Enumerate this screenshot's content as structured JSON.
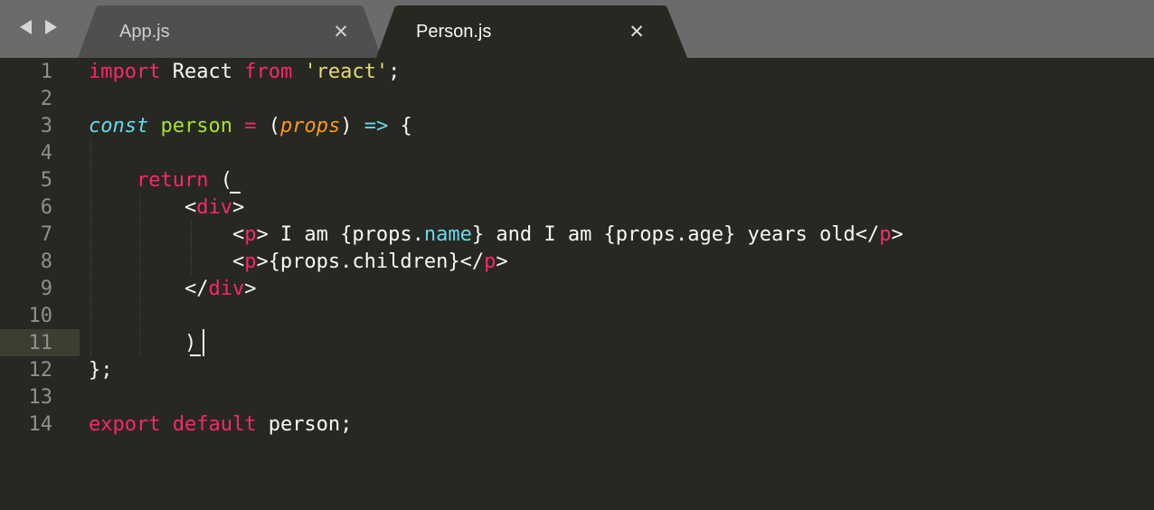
{
  "nav": {
    "back_icon": "back-arrow-icon",
    "forward_icon": "forward-arrow-icon"
  },
  "tabs": [
    {
      "label": "App.js",
      "active": false,
      "close_glyph": "✕"
    },
    {
      "label": "Person.js",
      "active": true,
      "close_glyph": "✕"
    }
  ],
  "colors": {
    "background": "#272822",
    "tabbar": "#6b6b6b",
    "inactive_tab": "#4f4f4f",
    "active_tab": "#272822",
    "line_highlight": "#3e3d32",
    "keyword": "#f92672",
    "string": "#e6db74",
    "storage": "#66d9ef",
    "function": "#a6e22e",
    "parameter": "#fd971f"
  },
  "editor": {
    "current_line": 11,
    "line_numbers": [
      "1",
      "2",
      "3",
      "4",
      "5",
      "6",
      "7",
      "8",
      "9",
      "10",
      "11",
      "12",
      "13",
      "14"
    ],
    "lines": [
      [
        {
          "t": "import",
          "c": "kw"
        },
        {
          "t": " React ",
          "c": "plain"
        },
        {
          "t": "from",
          "c": "kw"
        },
        {
          "t": " ",
          "c": "plain"
        },
        {
          "t": "'react'",
          "c": "str"
        },
        {
          "t": ";",
          "c": "plain"
        }
      ],
      [],
      [
        {
          "t": "const",
          "c": "stor"
        },
        {
          "t": " ",
          "c": "plain"
        },
        {
          "t": "person",
          "c": "fn"
        },
        {
          "t": " ",
          "c": "plain"
        },
        {
          "t": "=",
          "c": "op"
        },
        {
          "t": " (",
          "c": "plain"
        },
        {
          "t": "props",
          "c": "param"
        },
        {
          "t": ") ",
          "c": "plain"
        },
        {
          "t": "=>",
          "c": "arrow"
        },
        {
          "t": " {",
          "c": "plain"
        }
      ],
      [],
      [
        {
          "t": "    ",
          "c": "plain"
        },
        {
          "t": "return",
          "c": "kw"
        },
        {
          "t": " (",
          "c": "plain"
        }
      ],
      [
        {
          "t": "        <",
          "c": "plain"
        },
        {
          "t": "div",
          "c": "tag"
        },
        {
          "t": ">",
          "c": "plain"
        }
      ],
      [
        {
          "t": "            <",
          "c": "plain"
        },
        {
          "t": "p",
          "c": "tag"
        },
        {
          "t": "> I am {props.",
          "c": "plain"
        },
        {
          "t": "name",
          "c": "prop"
        },
        {
          "t": "} and I am {props.age} years old</",
          "c": "plain"
        },
        {
          "t": "p",
          "c": "tag"
        },
        {
          "t": ">",
          "c": "plain"
        }
      ],
      [
        {
          "t": "            <",
          "c": "plain"
        },
        {
          "t": "p",
          "c": "tag"
        },
        {
          "t": ">{props.children}</",
          "c": "plain"
        },
        {
          "t": "p",
          "c": "tag"
        },
        {
          "t": ">",
          "c": "plain"
        }
      ],
      [
        {
          "t": "        </",
          "c": "plain"
        },
        {
          "t": "div",
          "c": "tag"
        },
        {
          "t": ">",
          "c": "plain"
        }
      ],
      [],
      [
        {
          "t": "        )",
          "c": "plain"
        }
      ],
      [
        {
          "t": "};",
          "c": "plain"
        }
      ],
      [],
      [
        {
          "t": "export",
          "c": "kw"
        },
        {
          "t": " ",
          "c": "plain"
        },
        {
          "t": "default",
          "c": "kw"
        },
        {
          "t": " person;",
          "c": "plain"
        }
      ]
    ]
  }
}
